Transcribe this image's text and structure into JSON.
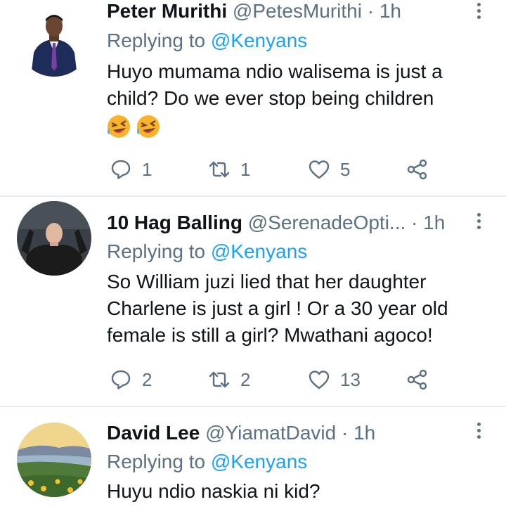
{
  "tweets": [
    {
      "display_name": "Peter Murithi",
      "handle": "@PetesMurithi",
      "separator": "·",
      "time": "1h",
      "replying_prefix": "Replying to",
      "replying_to": "@Kenyans",
      "text_lines": [
        "Huyo mumama ndio walisema is just a",
        "child? Do we ever stop being children"
      ],
      "emoji": [
        "rolling-on-floor-laughing",
        "rolling-on-floor-laughing"
      ],
      "replies": "1",
      "retweets": "1",
      "likes": "5"
    },
    {
      "display_name": "10 Hag Balling",
      "handle": "@SerenadeOpti...",
      "separator": "·",
      "time": "1h",
      "replying_prefix": "Replying to",
      "replying_to": "@Kenyans",
      "text_lines": [
        "So William juzi lied that her daughter",
        "Charlene is just a girl ! Or a 30 year old",
        "female is still a girl? Mwathani agoco!"
      ],
      "replies": "2",
      "retweets": "2",
      "likes": "13"
    },
    {
      "display_name": "David Lee",
      "handle": "@YiamatDavid",
      "separator": "·",
      "time": "1h",
      "replying_prefix": "Replying to",
      "replying_to": "@Kenyans",
      "text_lines": [
        "Huyu ndio naskia ni kid?"
      ]
    }
  ],
  "colors": {
    "text": "#0f1419",
    "secondary": "#5b7083",
    "link": "#1da1f2",
    "divider": "#e6ecf0"
  },
  "icons": [
    "reply-icon",
    "retweet-icon",
    "like-icon",
    "share-icon",
    "more-options-icon"
  ]
}
